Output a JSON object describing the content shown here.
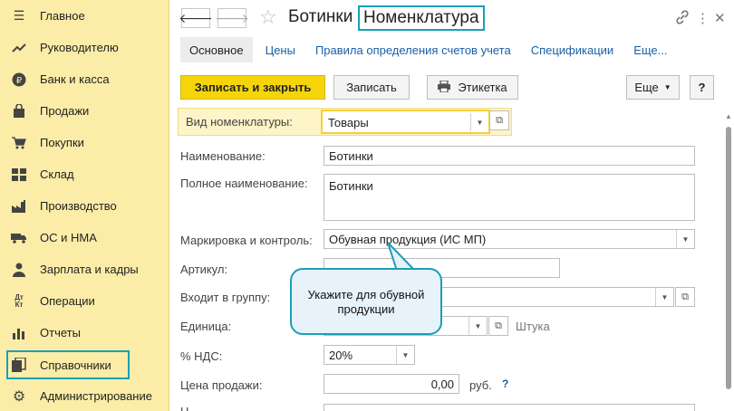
{
  "sidebar": {
    "items": [
      {
        "label": "Главное",
        "icon": "menu-icon"
      },
      {
        "label": "Руководителю",
        "icon": "trend-icon"
      },
      {
        "label": "Банк и касса",
        "icon": "ruble-icon"
      },
      {
        "label": "Продажи",
        "icon": "bag-icon"
      },
      {
        "label": "Покупки",
        "icon": "cart-icon"
      },
      {
        "label": "Склад",
        "icon": "warehouse-icon"
      },
      {
        "label": "Производство",
        "icon": "factory-icon"
      },
      {
        "label": "ОС и НМА",
        "icon": "truck-icon"
      },
      {
        "label": "Зарплата и кадры",
        "icon": "person-icon"
      },
      {
        "label": "Операции",
        "icon": "dt-kt-icon"
      },
      {
        "label": "Отчеты",
        "icon": "bar-chart-icon"
      },
      {
        "label": "Справочники",
        "icon": "books-icon"
      },
      {
        "label": "Администрирование",
        "icon": "gear-icon"
      }
    ],
    "active_index": 11
  },
  "header": {
    "title_prefix": "Ботинки",
    "title_suffix": "Номенклатура",
    "back": "🡐",
    "forward": "🡒"
  },
  "tabs": [
    "Основное",
    "Цены",
    "Правила определения счетов учета",
    "Спецификации",
    "Еще..."
  ],
  "toolbar": {
    "save_close": "Записать и закрыть",
    "save": "Записать",
    "label": "Этикетка",
    "more": "Еще",
    "help": "?"
  },
  "form": {
    "vid_label": "Вид номенклатуры:",
    "vid_value": "Товары",
    "name_label": "Наименование:",
    "name_value": "Ботинки",
    "full_name_label": "Полное наименование:",
    "full_name_value": "Ботинки",
    "marking_label": "Маркировка и контроль:",
    "marking_value": "Обувная продукция (ИС МП)",
    "article_label": "Артикул:",
    "article_value": "",
    "group_label": "Входит в группу:",
    "group_value": "",
    "unit_label": "Единица:",
    "unit_value": "",
    "unit_name": "Штука",
    "vat_label": "% НДС:",
    "vat_value": "20%",
    "price_label": "Цена продажи:",
    "price_value": "0,00",
    "price_currency": "руб.",
    "price_help": "?"
  },
  "tooltip": {
    "line1": "Укажите для обувной",
    "line2": "продукции"
  },
  "colors": {
    "sidebar_bg": "#fbeda7",
    "accent": "#1aa0b4",
    "primary_button": "#f5d50a",
    "link": "#1a5fa8"
  }
}
